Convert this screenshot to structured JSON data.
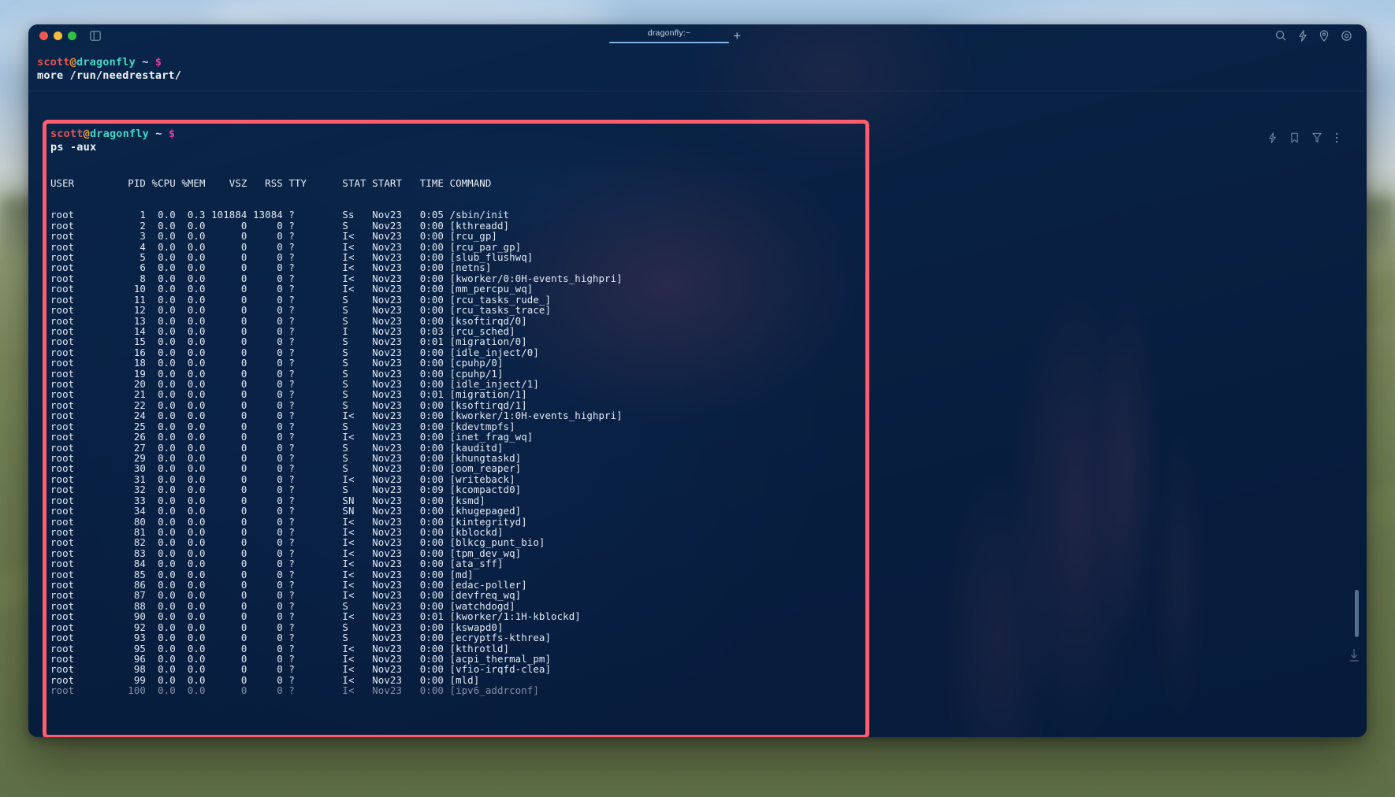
{
  "window": {
    "traffic_lights": [
      "close",
      "minimize",
      "maximize"
    ],
    "tab_label": "dragonfly:~",
    "new_tab_label": "+",
    "titlebar_icons": [
      "sidebar-toggle-icon",
      "search-icon",
      "lightning-icon",
      "location-pin-icon",
      "gear-icon"
    ],
    "block_icons": [
      "lightning-icon",
      "bookmark-icon",
      "filter-icon",
      "more-vertical-icon"
    ]
  },
  "colors": {
    "prompt_user": "#e8544f",
    "prompt_at": "#e89a3c",
    "prompt_host": "#3fd7c8",
    "prompt_dollar": "#e040a0",
    "highlight_border": "#ff5c6e",
    "terminal_bg": "#0c2244",
    "tab_underline": "#7fb3e8"
  },
  "prompt": {
    "user": "scott",
    "at": "@",
    "host": "dragonfly",
    "cwd": "~",
    "symbol": "$"
  },
  "blocks": [
    {
      "command": "more /run/needrestart/"
    },
    {
      "command": "ps -aux"
    }
  ],
  "ps_output": {
    "header": "USER         PID %CPU %MEM    VSZ   RSS TTY      STAT START   TIME COMMAND",
    "rows": [
      "root           1  0.0  0.3 101884 13084 ?        Ss   Nov23   0:05 /sbin/init",
      "root           2  0.0  0.0      0     0 ?        S    Nov23   0:00 [kthreadd]",
      "root           3  0.0  0.0      0     0 ?        I<   Nov23   0:00 [rcu_gp]",
      "root           4  0.0  0.0      0     0 ?        I<   Nov23   0:00 [rcu_par_gp]",
      "root           5  0.0  0.0      0     0 ?        I<   Nov23   0:00 [slub_flushwq]",
      "root           6  0.0  0.0      0     0 ?        I<   Nov23   0:00 [netns]",
      "root           8  0.0  0.0      0     0 ?        I<   Nov23   0:00 [kworker/0:0H-events_highpri]",
      "root          10  0.0  0.0      0     0 ?        I<   Nov23   0:00 [mm_percpu_wq]",
      "root          11  0.0  0.0      0     0 ?        S    Nov23   0:00 [rcu_tasks_rude_]",
      "root          12  0.0  0.0      0     0 ?        S    Nov23   0:00 [rcu_tasks_trace]",
      "root          13  0.0  0.0      0     0 ?        S    Nov23   0:00 [ksoftirqd/0]",
      "root          14  0.0  0.0      0     0 ?        I    Nov23   0:03 [rcu_sched]",
      "root          15  0.0  0.0      0     0 ?        S    Nov23   0:01 [migration/0]",
      "root          16  0.0  0.0      0     0 ?        S    Nov23   0:00 [idle_inject/0]",
      "root          18  0.0  0.0      0     0 ?        S    Nov23   0:00 [cpuhp/0]",
      "root          19  0.0  0.0      0     0 ?        S    Nov23   0:00 [cpuhp/1]",
      "root          20  0.0  0.0      0     0 ?        S    Nov23   0:00 [idle_inject/1]",
      "root          21  0.0  0.0      0     0 ?        S    Nov23   0:01 [migration/1]",
      "root          22  0.0  0.0      0     0 ?        S    Nov23   0:00 [ksoftirqd/1]",
      "root          24  0.0  0.0      0     0 ?        I<   Nov23   0:00 [kworker/1:0H-events_highpri]",
      "root          25  0.0  0.0      0     0 ?        S    Nov23   0:00 [kdevtmpfs]",
      "root          26  0.0  0.0      0     0 ?        I<   Nov23   0:00 [inet_frag_wq]",
      "root          27  0.0  0.0      0     0 ?        S    Nov23   0:00 [kauditd]",
      "root          29  0.0  0.0      0     0 ?        S    Nov23   0:00 [khungtaskd]",
      "root          30  0.0  0.0      0     0 ?        S    Nov23   0:00 [oom_reaper]",
      "root          31  0.0  0.0      0     0 ?        I<   Nov23   0:00 [writeback]",
      "root          32  0.0  0.0      0     0 ?        S    Nov23   0:09 [kcompactd0]",
      "root          33  0.0  0.0      0     0 ?        SN   Nov23   0:00 [ksmd]",
      "root          34  0.0  0.0      0     0 ?        SN   Nov23   0:00 [khugepaged]",
      "root          80  0.0  0.0      0     0 ?        I<   Nov23   0:00 [kintegrityd]",
      "root          81  0.0  0.0      0     0 ?        I<   Nov23   0:00 [kblockd]",
      "root          82  0.0  0.0      0     0 ?        I<   Nov23   0:00 [blkcg_punt_bio]",
      "root          83  0.0  0.0      0     0 ?        I<   Nov23   0:00 [tpm_dev_wq]",
      "root          84  0.0  0.0      0     0 ?        I<   Nov23   0:00 [ata_sff]",
      "root          85  0.0  0.0      0     0 ?        I<   Nov23   0:00 [md]",
      "root          86  0.0  0.0      0     0 ?        I<   Nov23   0:00 [edac-poller]",
      "root          87  0.0  0.0      0     0 ?        I<   Nov23   0:00 [devfreq_wq]",
      "root          88  0.0  0.0      0     0 ?        S    Nov23   0:00 [watchdogd]",
      "root          90  0.0  0.0      0     0 ?        I<   Nov23   0:01 [kworker/1:1H-kblockd]",
      "root          92  0.0  0.0      0     0 ?        S    Nov23   0:00 [kswapd0]",
      "root          93  0.0  0.0      0     0 ?        S    Nov23   0:00 [ecryptfs-kthrea]",
      "root          95  0.0  0.0      0     0 ?        I<   Nov23   0:00 [kthrotld]",
      "root          96  0.0  0.0      0     0 ?        I<   Nov23   0:00 [acpi_thermal_pm]",
      "root          98  0.0  0.0      0     0 ?        I<   Nov23   0:00 [vfio-irqfd-clea]",
      "root          99  0.0  0.0      0     0 ?        I<   Nov23   0:00 [mld]",
      "root         100  0.0  0.0      0     0 ?        I<   Nov23   0:00 [ipv6_addrconf]"
    ]
  }
}
